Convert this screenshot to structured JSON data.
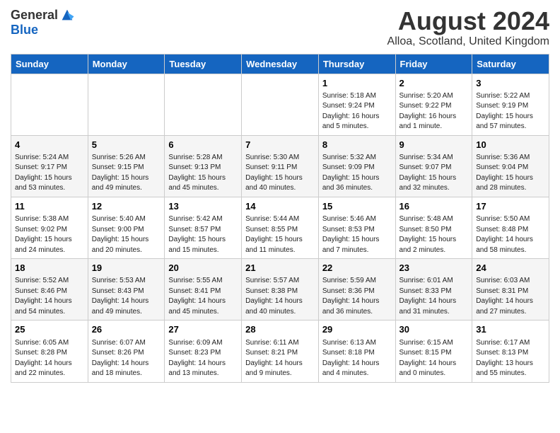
{
  "header": {
    "logo_general": "General",
    "logo_blue": "Blue",
    "month_title": "August 2024",
    "location": "Alloa, Scotland, United Kingdom"
  },
  "days_of_week": [
    "Sunday",
    "Monday",
    "Tuesday",
    "Wednesday",
    "Thursday",
    "Friday",
    "Saturday"
  ],
  "weeks": [
    [
      {
        "day": "",
        "info": ""
      },
      {
        "day": "",
        "info": ""
      },
      {
        "day": "",
        "info": ""
      },
      {
        "day": "",
        "info": ""
      },
      {
        "day": "1",
        "info": "Sunrise: 5:18 AM\nSunset: 9:24 PM\nDaylight: 16 hours\nand 5 minutes."
      },
      {
        "day": "2",
        "info": "Sunrise: 5:20 AM\nSunset: 9:22 PM\nDaylight: 16 hours\nand 1 minute."
      },
      {
        "day": "3",
        "info": "Sunrise: 5:22 AM\nSunset: 9:19 PM\nDaylight: 15 hours\nand 57 minutes."
      }
    ],
    [
      {
        "day": "4",
        "info": "Sunrise: 5:24 AM\nSunset: 9:17 PM\nDaylight: 15 hours\nand 53 minutes."
      },
      {
        "day": "5",
        "info": "Sunrise: 5:26 AM\nSunset: 9:15 PM\nDaylight: 15 hours\nand 49 minutes."
      },
      {
        "day": "6",
        "info": "Sunrise: 5:28 AM\nSunset: 9:13 PM\nDaylight: 15 hours\nand 45 minutes."
      },
      {
        "day": "7",
        "info": "Sunrise: 5:30 AM\nSunset: 9:11 PM\nDaylight: 15 hours\nand 40 minutes."
      },
      {
        "day": "8",
        "info": "Sunrise: 5:32 AM\nSunset: 9:09 PM\nDaylight: 15 hours\nand 36 minutes."
      },
      {
        "day": "9",
        "info": "Sunrise: 5:34 AM\nSunset: 9:07 PM\nDaylight: 15 hours\nand 32 minutes."
      },
      {
        "day": "10",
        "info": "Sunrise: 5:36 AM\nSunset: 9:04 PM\nDaylight: 15 hours\nand 28 minutes."
      }
    ],
    [
      {
        "day": "11",
        "info": "Sunrise: 5:38 AM\nSunset: 9:02 PM\nDaylight: 15 hours\nand 24 minutes."
      },
      {
        "day": "12",
        "info": "Sunrise: 5:40 AM\nSunset: 9:00 PM\nDaylight: 15 hours\nand 20 minutes."
      },
      {
        "day": "13",
        "info": "Sunrise: 5:42 AM\nSunset: 8:57 PM\nDaylight: 15 hours\nand 15 minutes."
      },
      {
        "day": "14",
        "info": "Sunrise: 5:44 AM\nSunset: 8:55 PM\nDaylight: 15 hours\nand 11 minutes."
      },
      {
        "day": "15",
        "info": "Sunrise: 5:46 AM\nSunset: 8:53 PM\nDaylight: 15 hours\nand 7 minutes."
      },
      {
        "day": "16",
        "info": "Sunrise: 5:48 AM\nSunset: 8:50 PM\nDaylight: 15 hours\nand 2 minutes."
      },
      {
        "day": "17",
        "info": "Sunrise: 5:50 AM\nSunset: 8:48 PM\nDaylight: 14 hours\nand 58 minutes."
      }
    ],
    [
      {
        "day": "18",
        "info": "Sunrise: 5:52 AM\nSunset: 8:46 PM\nDaylight: 14 hours\nand 54 minutes."
      },
      {
        "day": "19",
        "info": "Sunrise: 5:53 AM\nSunset: 8:43 PM\nDaylight: 14 hours\nand 49 minutes."
      },
      {
        "day": "20",
        "info": "Sunrise: 5:55 AM\nSunset: 8:41 PM\nDaylight: 14 hours\nand 45 minutes."
      },
      {
        "day": "21",
        "info": "Sunrise: 5:57 AM\nSunset: 8:38 PM\nDaylight: 14 hours\nand 40 minutes."
      },
      {
        "day": "22",
        "info": "Sunrise: 5:59 AM\nSunset: 8:36 PM\nDaylight: 14 hours\nand 36 minutes."
      },
      {
        "day": "23",
        "info": "Sunrise: 6:01 AM\nSunset: 8:33 PM\nDaylight: 14 hours\nand 31 minutes."
      },
      {
        "day": "24",
        "info": "Sunrise: 6:03 AM\nSunset: 8:31 PM\nDaylight: 14 hours\nand 27 minutes."
      }
    ],
    [
      {
        "day": "25",
        "info": "Sunrise: 6:05 AM\nSunset: 8:28 PM\nDaylight: 14 hours\nand 22 minutes."
      },
      {
        "day": "26",
        "info": "Sunrise: 6:07 AM\nSunset: 8:26 PM\nDaylight: 14 hours\nand 18 minutes."
      },
      {
        "day": "27",
        "info": "Sunrise: 6:09 AM\nSunset: 8:23 PM\nDaylight: 14 hours\nand 13 minutes."
      },
      {
        "day": "28",
        "info": "Sunrise: 6:11 AM\nSunset: 8:21 PM\nDaylight: 14 hours\nand 9 minutes."
      },
      {
        "day": "29",
        "info": "Sunrise: 6:13 AM\nSunset: 8:18 PM\nDaylight: 14 hours\nand 4 minutes."
      },
      {
        "day": "30",
        "info": "Sunrise: 6:15 AM\nSunset: 8:15 PM\nDaylight: 14 hours\nand 0 minutes."
      },
      {
        "day": "31",
        "info": "Sunrise: 6:17 AM\nSunset: 8:13 PM\nDaylight: 13 hours\nand 55 minutes."
      }
    ]
  ]
}
